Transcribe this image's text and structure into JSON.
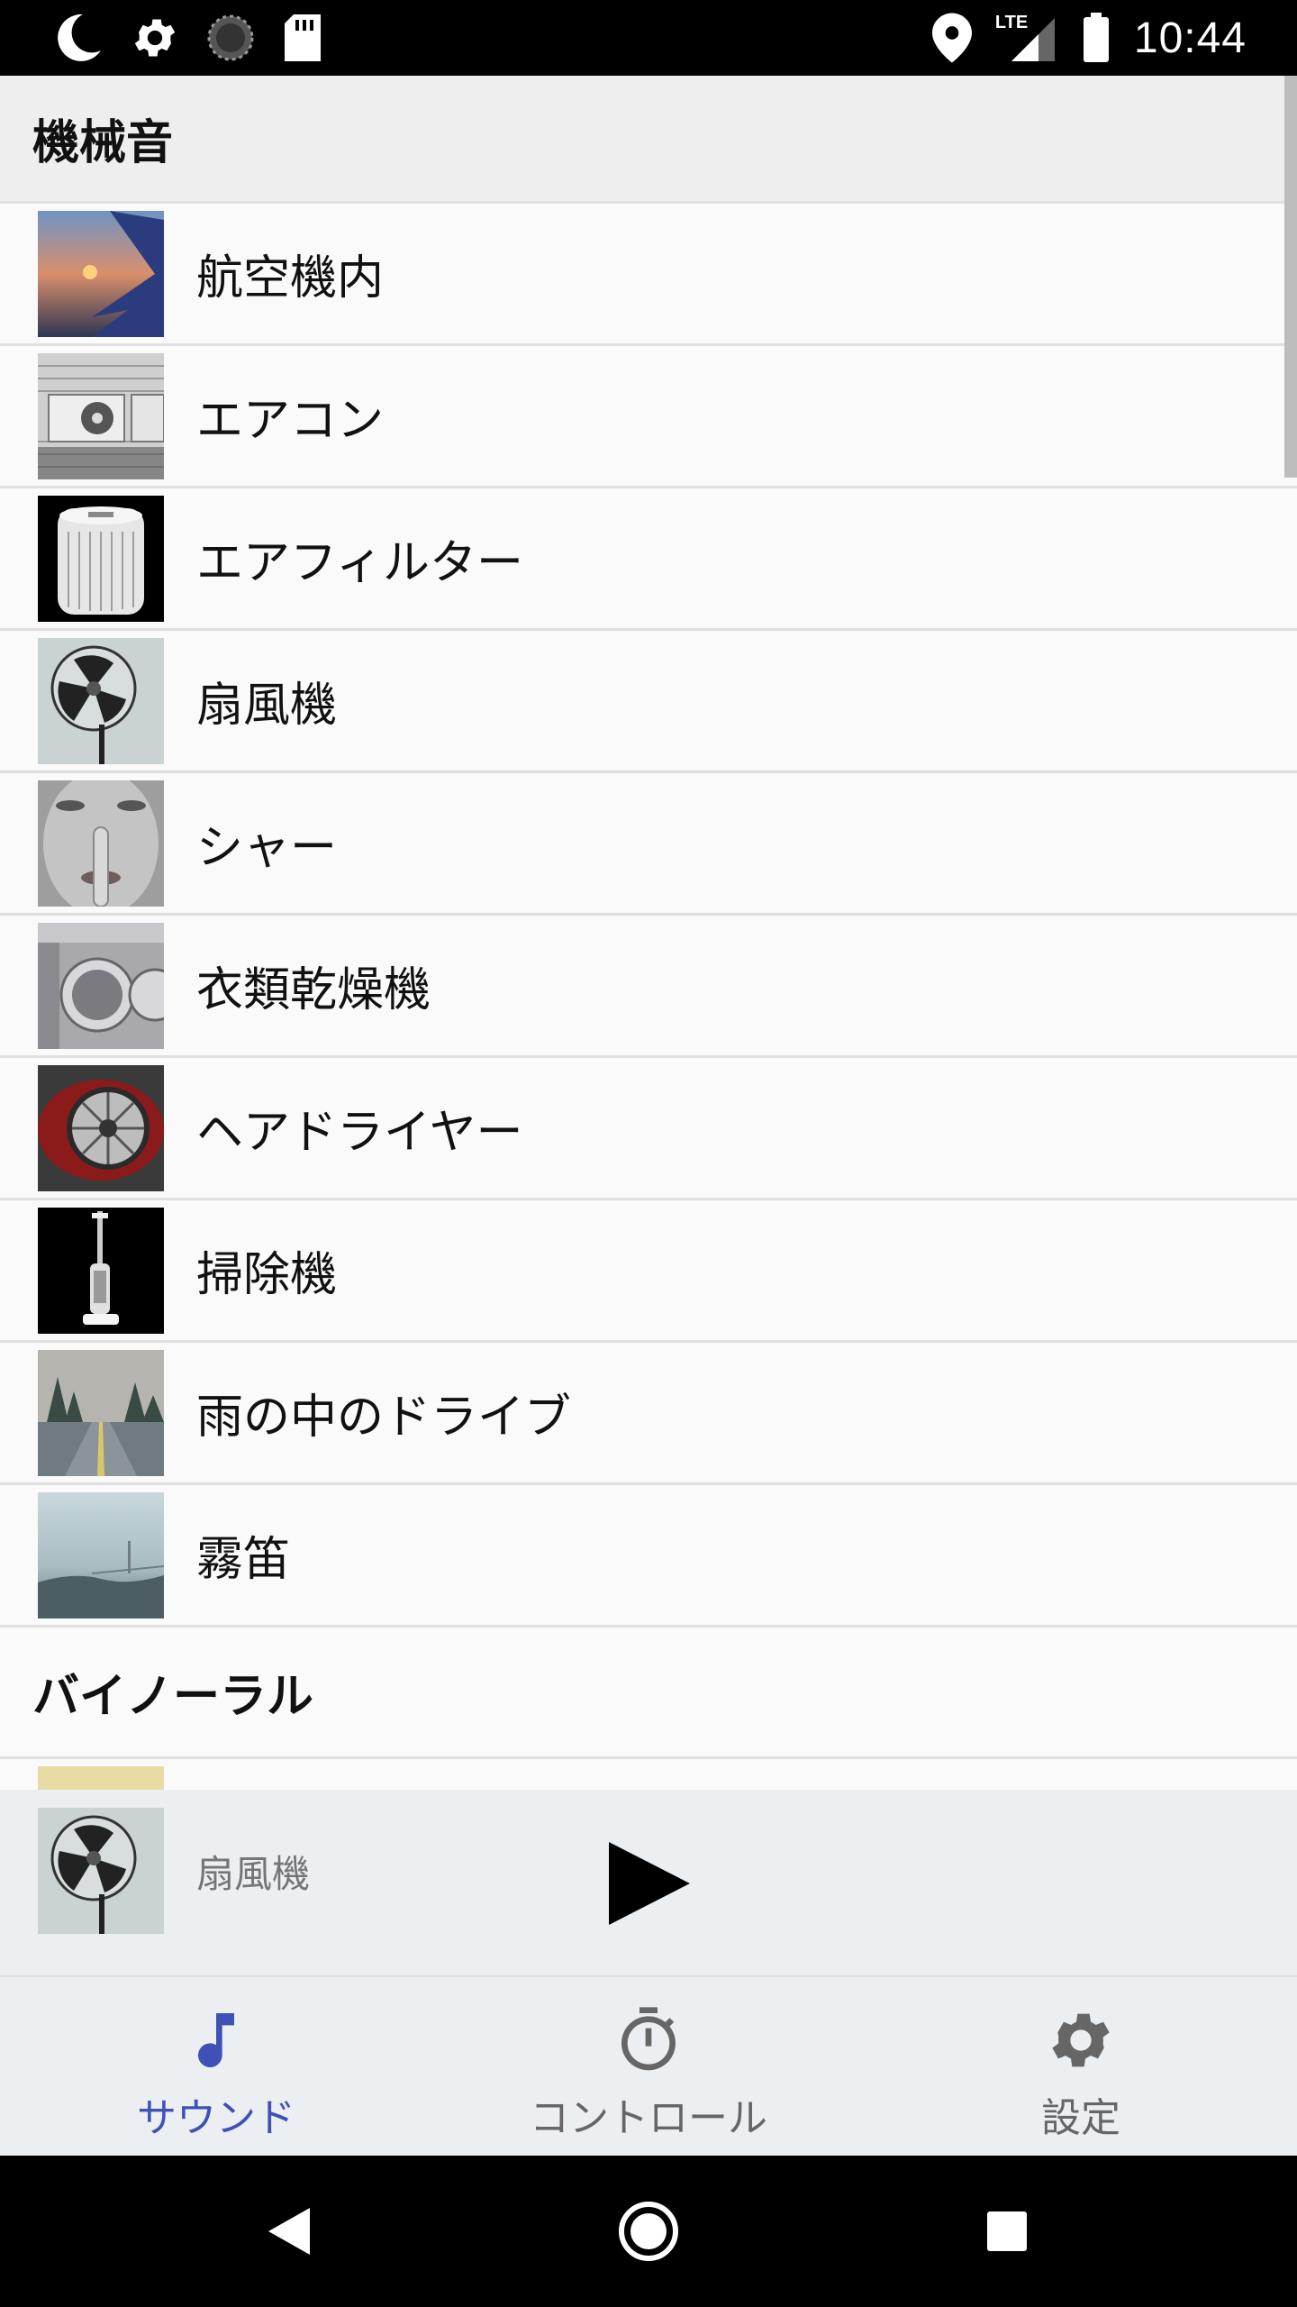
{
  "status_bar": {
    "time": "10:44",
    "network_label": "LTE",
    "icons": [
      "moon-icon",
      "gear-icon",
      "loading-icon",
      "sd-card-icon",
      "location-icon",
      "signal-icon",
      "battery-icon"
    ]
  },
  "sections": [
    {
      "title": "機械音",
      "items": [
        {
          "label": "航空機内",
          "thumb": "airplane-window"
        },
        {
          "label": "エアコン",
          "thumb": "air-conditioner"
        },
        {
          "label": "エアフィルター",
          "thumb": "air-filter"
        },
        {
          "label": "扇風機",
          "thumb": "fan"
        },
        {
          "label": "シャー",
          "thumb": "shush"
        },
        {
          "label": "衣類乾燥機",
          "thumb": "clothes-dryer"
        },
        {
          "label": "ヘアドライヤー",
          "thumb": "hair-dryer"
        },
        {
          "label": "掃除機",
          "thumb": "vacuum"
        },
        {
          "label": "雨の中のドライブ",
          "thumb": "rain-drive"
        },
        {
          "label": "霧笛",
          "thumb": "foghorn"
        }
      ]
    },
    {
      "title": "バイノーラル",
      "items": []
    }
  ],
  "now_playing": {
    "title": "扇風機",
    "thumb": "fan"
  },
  "bottom_nav": {
    "tabs": [
      {
        "label": "サウンド",
        "icon": "music-note-icon",
        "active": true
      },
      {
        "label": "コントロール",
        "icon": "timer-icon",
        "active": false
      },
      {
        "label": "設定",
        "icon": "gear-icon",
        "active": false
      }
    ]
  },
  "colors": {
    "accent": "#3f51b5",
    "inactive": "#666666",
    "header_bg": "#eeeeee",
    "bar_bg": "#eceff1"
  }
}
